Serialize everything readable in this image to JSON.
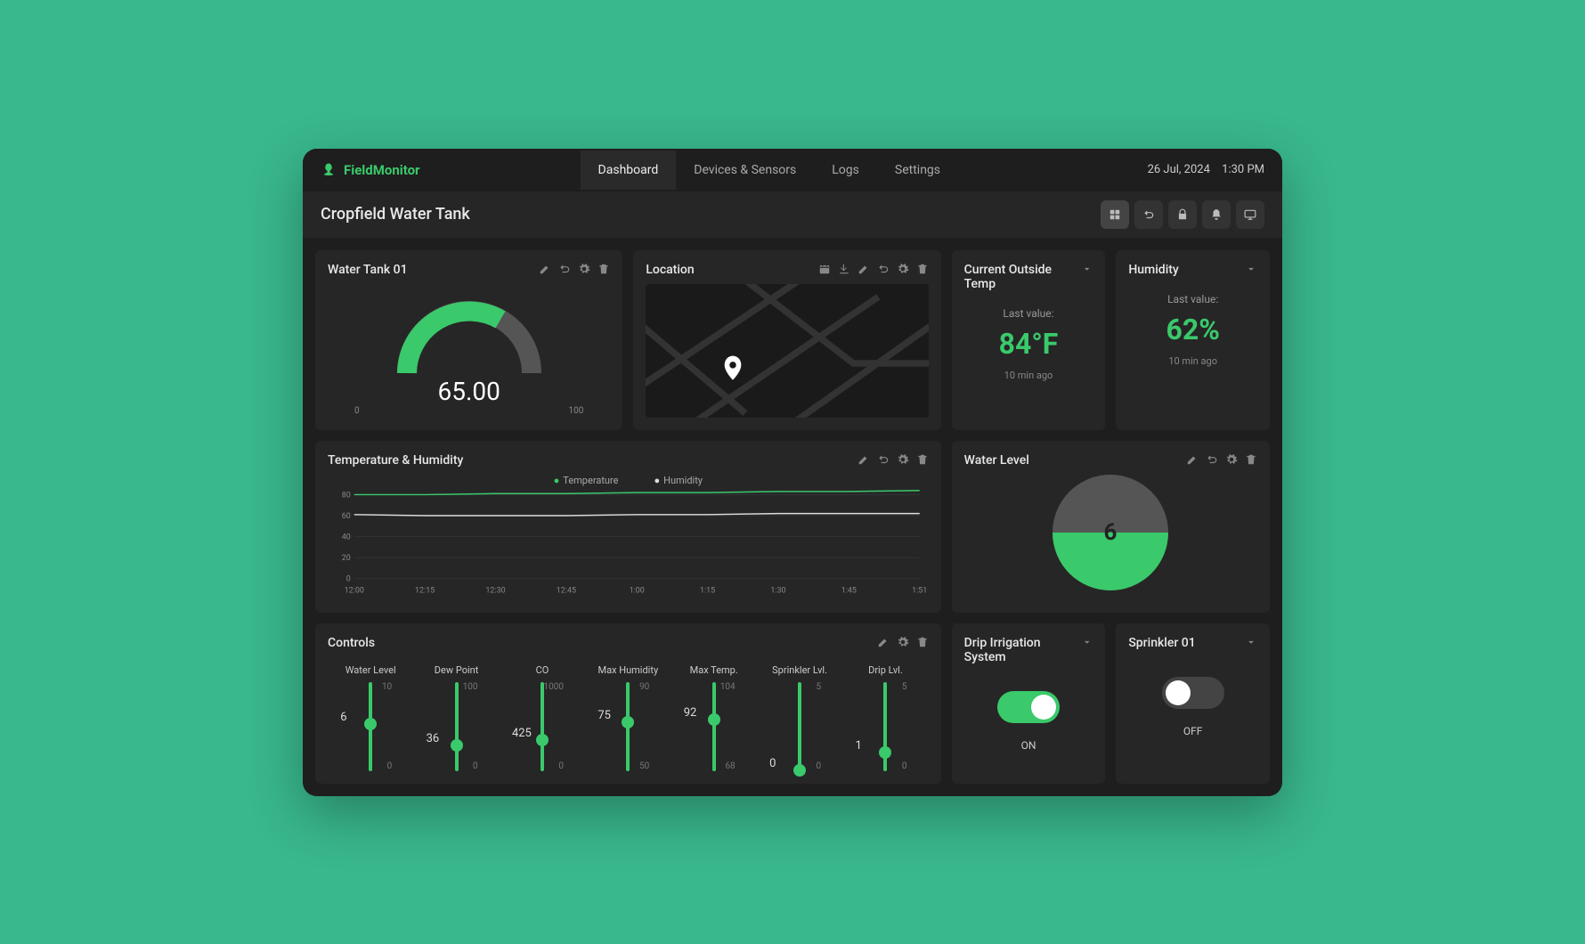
{
  "app": {
    "name": "FieldMonitor"
  },
  "nav": {
    "items": [
      "Dashboard",
      "Devices & Sensors",
      "Logs",
      "Settings"
    ],
    "active": 0
  },
  "header": {
    "date": "26 Jul, 2024",
    "time": "1:30 PM",
    "page_title": "Cropfield Water Tank"
  },
  "cards": {
    "water_tank": {
      "title": "Water Tank 01",
      "value": "65.00",
      "min_label": "0",
      "max_label": "100",
      "gauge_percent": 65
    },
    "location": {
      "title": "Location"
    },
    "temp": {
      "title": "Current Outside Temp",
      "last_label": "Last value:",
      "value": "84°F",
      "ago": "10 min ago"
    },
    "humidity": {
      "title": "Humidity",
      "last_label": "Last value:",
      "value": "62%",
      "ago": "10 min ago"
    },
    "temp_hum_chart": {
      "title": "Temperature & Humidity",
      "legend": {
        "temp": "Temperature",
        "hum": "Humidity"
      }
    },
    "water_level": {
      "title": "Water Level",
      "value": "6",
      "fill_percent": 50
    },
    "controls": {
      "title": "Controls",
      "sliders": [
        {
          "label": "Water Level",
          "value": "6",
          "min": "0",
          "max": "10",
          "pos": 40
        },
        {
          "label": "Dew Point",
          "value": "36",
          "min": "0",
          "max": "100",
          "pos": 64
        },
        {
          "label": "CO",
          "value": "425",
          "min": "0",
          "max": "1000",
          "pos": 58
        },
        {
          "label": "Max Humidity",
          "value": "75",
          "min": "50",
          "max": "90",
          "pos": 38
        },
        {
          "label": "Max Temp.",
          "value": "92",
          "min": "68",
          "max": "104",
          "pos": 35
        },
        {
          "label": "Sprinkler Lvl.",
          "value": "0",
          "min": "0",
          "max": "5",
          "pos": 92
        },
        {
          "label": "Drip Lvl.",
          "value": "1",
          "min": "0",
          "max": "5",
          "pos": 72
        }
      ]
    },
    "drip": {
      "title": "Drip Irrigation System",
      "state": "ON"
    },
    "sprinkler": {
      "title": "Sprinkler 01",
      "state": "OFF"
    }
  },
  "chart_data": {
    "type": "line",
    "title": "Temperature & Humidity",
    "xlabel": "",
    "ylabel": "",
    "ylim": [
      0,
      80
    ],
    "y_ticks": [
      0,
      20,
      40,
      60,
      80
    ],
    "categories": [
      "12:00",
      "12:15",
      "12:30",
      "12:45",
      "1:00",
      "1:15",
      "1:30",
      "1:45",
      "1:51"
    ],
    "series": [
      {
        "name": "Temperature",
        "color": "#3ac96b",
        "values": [
          80,
          80,
          81,
          81,
          82,
          82,
          83,
          83,
          84
        ]
      },
      {
        "name": "Humidity",
        "color": "#dddddd",
        "values": [
          61,
          60,
          60,
          60,
          61,
          61,
          62,
          62,
          62
        ]
      }
    ]
  }
}
